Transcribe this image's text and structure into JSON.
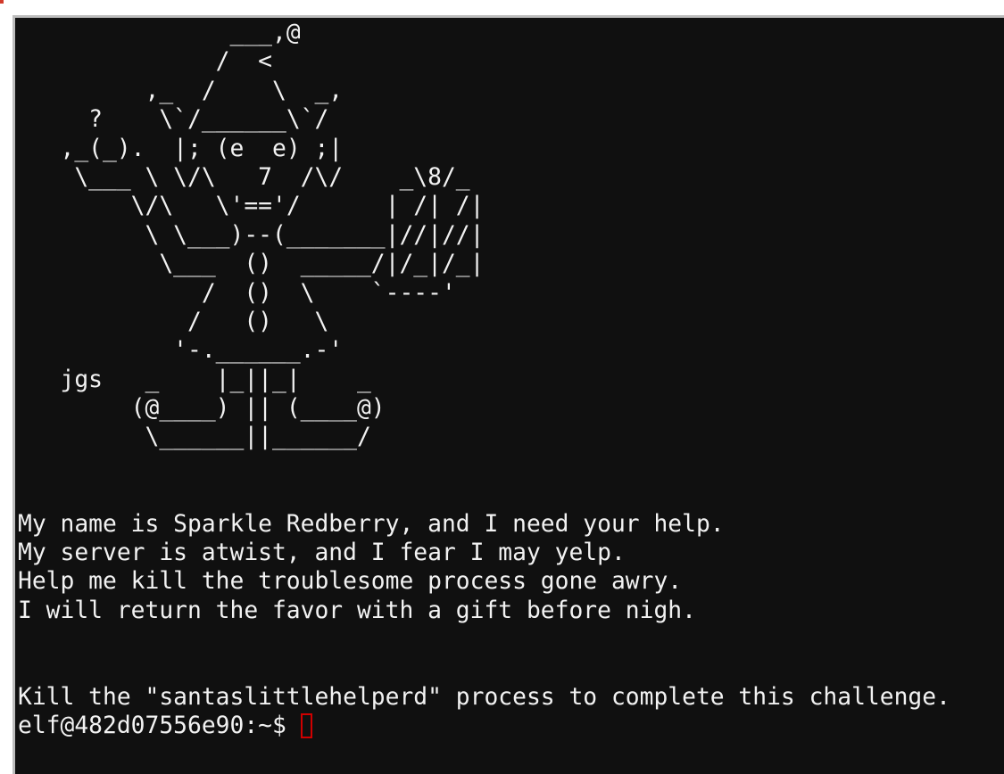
{
  "terminal": {
    "ascii_art": [
      "            ___,@",
      "           /  <",
      "      ,_  /    \\  _,",
      "  ?    \\`/______\\`/",
      ",_(_).  |; (e  e) ;|",
      " \\___ \\ \\/\\   7  /\\/    _\\8/_",
      "     \\/\\   \\'=='/      | /| /|",
      "      \\ \\___)--(_______|//|//|",
      "       \\___  ()  _____/|/_|/_|",
      "          /  ()  \\    `----'",
      "         /   ()   \\",
      "        '-.______.-'",
      "jgs   _    |_||_|    _",
      "     (@____) || (____@)",
      "      \\______||______/"
    ],
    "message": [
      "My name is Sparkle Redberry, and I need your help.",
      "My server is atwist, and I fear I may yelp.",
      "Help me kill the troublesome process gone awry.",
      "I will return the favor with a gift before nigh."
    ],
    "instruction": "Kill the \"santaslittlehelperd\" process to complete this challenge.",
    "prompt": "elf@482d07556e90:~$ ",
    "input_value": ""
  },
  "colors": {
    "background": "#101010",
    "text": "#f2f2f2",
    "cursor": "#d00000"
  }
}
